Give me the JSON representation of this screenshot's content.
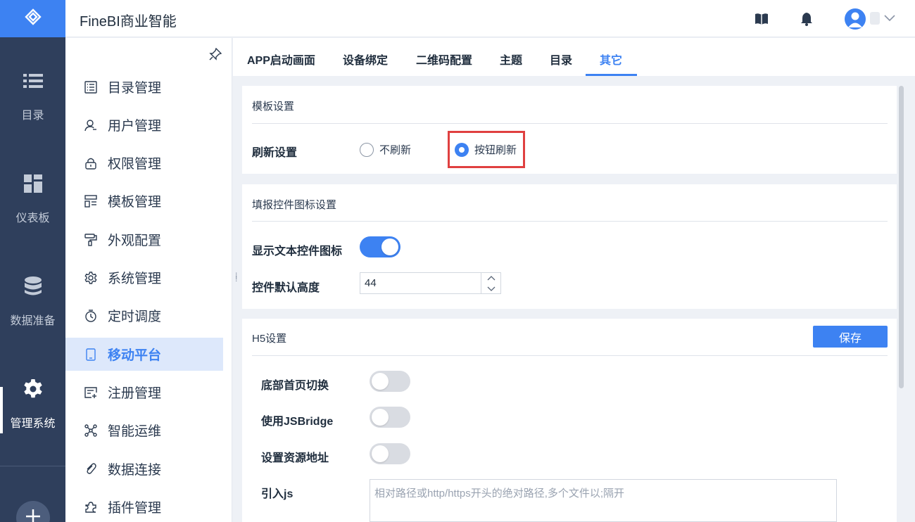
{
  "app": {
    "title": "FineBI商业智能"
  },
  "rail": {
    "items": [
      {
        "label": "目录",
        "icon": "list-icon"
      },
      {
        "label": "仪表板",
        "icon": "dashboard-icon"
      },
      {
        "label": "数据准备",
        "icon": "database-icon"
      },
      {
        "label": "管理系统",
        "icon": "gear-icon"
      }
    ]
  },
  "sidebar": {
    "items": [
      {
        "label": "目录管理",
        "icon": "catalog-icon"
      },
      {
        "label": "用户管理",
        "icon": "user-icon"
      },
      {
        "label": "权限管理",
        "icon": "lock-icon"
      },
      {
        "label": "模板管理",
        "icon": "template-icon"
      },
      {
        "label": "外观配置",
        "icon": "brush-icon"
      },
      {
        "label": "系统管理",
        "icon": "settings-icon"
      },
      {
        "label": "定时调度",
        "icon": "timer-icon"
      },
      {
        "label": "移动平台",
        "icon": "mobile-icon"
      },
      {
        "label": "注册管理",
        "icon": "register-icon"
      },
      {
        "label": "智能运维",
        "icon": "ops-icon"
      },
      {
        "label": "数据连接",
        "icon": "link-icon"
      },
      {
        "label": "插件管理",
        "icon": "plugin-icon"
      }
    ],
    "active": "移动平台"
  },
  "tabs": [
    {
      "label": "APP启动画面"
    },
    {
      "label": "设备绑定"
    },
    {
      "label": "二维码配置"
    },
    {
      "label": "主题"
    },
    {
      "label": "目录"
    },
    {
      "label": "其它"
    }
  ],
  "active_tab": "其它",
  "template_settings": {
    "title": "模板设置",
    "refresh_label": "刷新设置",
    "options": [
      {
        "label": "不刷新",
        "checked": false
      },
      {
        "label": "按钮刷新",
        "checked": true
      }
    ]
  },
  "fill_settings": {
    "title": "填报控件图标设置",
    "show_icon_label": "显示文本控件图标",
    "show_icon_on": true,
    "default_height_label": "控件默认高度",
    "default_height_value": "44"
  },
  "h5_settings": {
    "title": "H5设置",
    "save_label": "保存",
    "bottom_tab_label": "底部首页切换",
    "bottom_tab_on": false,
    "jsbridge_label": "使用JSBridge",
    "jsbridge_on": false,
    "resource_label": "设置资源地址",
    "resource_on": false,
    "js_label": "引入js",
    "js_placeholder": "相对路径或http/https开头的绝对路径,多个文件以;隔开",
    "js_value": ""
  },
  "colors": {
    "accent": "#3d82f2",
    "rail_bg": "#2f3f5c",
    "highlight": "#e04040"
  }
}
